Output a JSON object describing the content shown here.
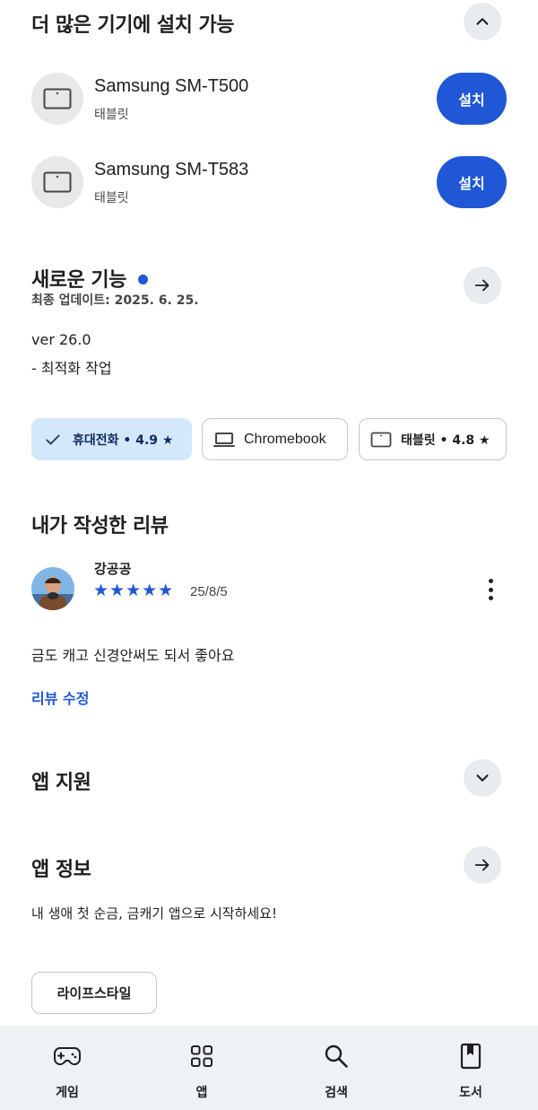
{
  "install_section": {
    "title": "더 많은 기기에 설치 가능",
    "collapse_icon": "chevron-up-icon",
    "devices": [
      {
        "name": "Samsung SM-T500",
        "type": "태블릿",
        "button": "설치",
        "icon": "tablet-icon"
      },
      {
        "name": "Samsung SM-T583",
        "type": "태블릿",
        "button": "설치",
        "icon": "tablet-icon"
      }
    ]
  },
  "whats_new": {
    "title": "새로운 기능",
    "updated": "최종 업데이트: 2025. 6. 25.",
    "version": "ver 26.0",
    "notes": "- 최적화 작업",
    "dot_color": "#1f57d6"
  },
  "device_chips": [
    {
      "label": "휴대전화 • 4.9 ★",
      "icon": "check-icon",
      "selected": true
    },
    {
      "label": "Chromebook",
      "icon": "laptop-icon",
      "selected": false
    },
    {
      "label": "태블릿 • 4.8 ★",
      "icon": "tablet-icon",
      "selected": false
    }
  ],
  "my_review": {
    "title": "내가 작성한 리뷰",
    "author": "강공공",
    "rating": 5,
    "stars": "★★★★★",
    "date": "25/8/5",
    "text": "금도 캐고 신경안써도 되서 좋아요",
    "edit_link": "리뷰 수정"
  },
  "app_support": {
    "title": "앱 지원",
    "icon": "chevron-down-icon"
  },
  "app_info": {
    "title": "앱 정보",
    "description": "내 생애 첫 순금, 금캐기 앱으로 시작하세요!",
    "category_chip": "라이프스타일"
  },
  "bottom_nav": [
    {
      "label": "게임",
      "icon": "gamepad-icon"
    },
    {
      "label": "앱",
      "icon": "apps-grid-icon"
    },
    {
      "label": "검색",
      "icon": "search-icon"
    },
    {
      "label": "도서",
      "icon": "book-icon"
    }
  ],
  "colors": {
    "accent": "#1f57d6",
    "chip_selected_bg": "#d3e8fb",
    "nav_bg": "#eef1f6"
  }
}
